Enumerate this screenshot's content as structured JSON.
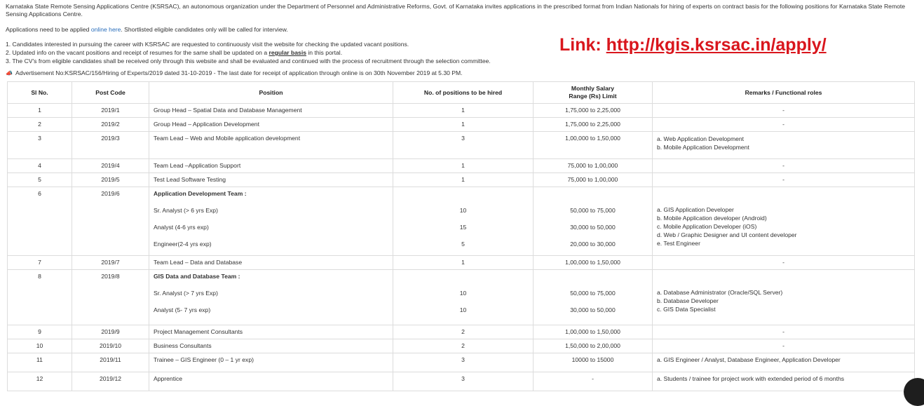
{
  "intro": {
    "paragraph": "Karnataka State Remote Sensing Applications Centre (KSRSAC), an autonomous organization under the Department of Personnel and Administrative Reforms, Govt. of Karnataka invites applications in the prescribed format from Indian Nationals for hiring of experts on contract basis for the following positions for Karnataka State Remote Sensing Applications Centre.",
    "apply_prefix": "Applications need to be applied ",
    "apply_link": "online here",
    "apply_suffix": ". Shortlisted eligible candidates only will be called for interview.",
    "note1": "1. Candidates interested in pursuing the career with KSRSAC are requested to continuously visit the website for checking the updated vacant positions.",
    "note2_prefix": "2. Updated info on the vacant positions and receipt of resumes for the same shall be updated on a ",
    "note2_underline": "regular basis",
    "note2_suffix": " in this portal.",
    "note3": "3. The CV's from eligible candidates shall be received only through this website and shall be evaluated and continued with the process of recruitment through the selection committee.",
    "advert": "Advertisement No:KSRSAC/156/Hiring of Experts/2019 dated 31-10-2019  -   The last date for receipt of application through online is on 30th November 2019 at 5.30 PM."
  },
  "banner": {
    "label": "Link: ",
    "url": "http://kgis.ksrsac.in/apply/"
  },
  "table": {
    "headers": {
      "sl": "Sl No.",
      "code": "Post Code",
      "position": "Position",
      "num": "No. of positions to be hired",
      "salary_line1": "Monthly Salary",
      "salary_line2": "Range (Rs) Limit",
      "remarks": "Remarks / Functional roles"
    },
    "rows": [
      {
        "sl": "1",
        "code": "2019/1",
        "position": "Group Head – Spatial Data and Database Management",
        "num": "1",
        "salary": "1,75,000 to 2,25,000",
        "remarks": "-"
      },
      {
        "sl": "2",
        "code": "2019/2",
        "position": "Group Head – Application Development",
        "num": "1",
        "salary": "1,75,000 to 2,25,000",
        "remarks": "-"
      },
      {
        "sl": "3",
        "code": "2019/3",
        "position": "Team Lead – Web and Mobile application development",
        "num": "3",
        "salary": "1,00,000 to 1,50,000",
        "remarks_list": [
          "a. Web Application Development",
          "b. Mobile Application Development"
        ]
      },
      {
        "sl": "4",
        "code": "2019/4",
        "position": "Team Lead –Application Support",
        "num": "1",
        "salary": "75,000 to 1,00,000",
        "remarks": "-"
      },
      {
        "sl": "5",
        "code": "2019/5",
        "position": "Test Lead Software Testing",
        "num": "1",
        "salary": "75,000 to 1,00,000",
        "remarks": "-"
      },
      {
        "sl": "6",
        "code": "2019/6",
        "group": "Application Development Team :",
        "sub": [
          {
            "position": "Sr. Analyst (> 6 yrs Exp)",
            "num": "10",
            "salary": "50,000 to 75,000"
          },
          {
            "position": "Analyst (4-6 yrs exp)",
            "num": "15",
            "salary": "30,000 to 50,000"
          },
          {
            "position": "Engineer(2-4 yrs exp)",
            "num": "5",
            "salary": "20,000 to 30,000"
          }
        ],
        "remarks_list": [
          "a. GIS Application Developer",
          "b. Mobile Application developer (Android)",
          "c. Mobile Application Developer (iOS)",
          "d. Web / Graphic Designer and UI content developer",
          "e. Test Engineer"
        ]
      },
      {
        "sl": "7",
        "code": "2019/7",
        "position": "Team Lead – Data and Database",
        "num": "1",
        "salary": "1,00,000 to 1,50,000",
        "remarks": "-"
      },
      {
        "sl": "8",
        "code": "2019/8",
        "group": "GIS Data and Database Team :",
        "sub": [
          {
            "position": "Sr. Analyst (> 7 yrs Exp)",
            "num": "10",
            "salary": "50,000 to 75,000"
          },
          {
            "position": "Analyst (5- 7 yrs exp)",
            "num": "10",
            "salary": "30,000 to 50,000"
          }
        ],
        "remarks_list": [
          "a. Database Administrator (Oracle/SQL Server)",
          "b. Database Developer",
          "c. GIS Data Specialist"
        ]
      },
      {
        "sl": "9",
        "code": "2019/9",
        "position": "Project Management Consultants",
        "num": "2",
        "salary": "1,00,000 to 1,50,000",
        "remarks": "-"
      },
      {
        "sl": "10",
        "code": "2019/10",
        "position": "Business Consultants",
        "num": "2",
        "salary": "1,50,000 to 2,00,000",
        "remarks": "-"
      },
      {
        "sl": "11",
        "code": "2019/11",
        "position": "Trainee – GIS Engineer (0 – 1 yr exp)",
        "num": "3",
        "salary": "10000 to 15000",
        "remarks": "a. GIS Engineer / Analyst, Database Engineer, Application Developer"
      },
      {
        "sl": "12",
        "code": "2019/12",
        "position": "Apprentice",
        "num": "3",
        "salary": "-",
        "remarks": "a. Students / trainee for project work with extended period of 6 months"
      }
    ]
  }
}
